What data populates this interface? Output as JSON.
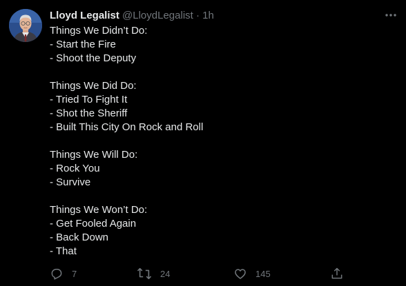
{
  "author": {
    "name": "Lloyd Legalist",
    "handle": "@LloydLegalist",
    "separator": "·",
    "time": "1h"
  },
  "tweet": {
    "lines": [
      "Things We Didn’t Do:",
      "- Start the Fire",
      "- Shoot the Deputy",
      "",
      "Things We Did Do:",
      "- Tried To Fight It",
      "- Shot the Sheriff",
      "- Built This City On Rock and Roll",
      "",
      "Things We Will Do:",
      "- Rock You",
      "- Survive",
      "",
      "Things We Won’t Do:",
      "- Get Fooled Again",
      "- Back Down",
      "- That"
    ]
  },
  "actions": {
    "reply": {
      "icon": "reply-icon",
      "count": "7"
    },
    "retweet": {
      "icon": "retweet-icon",
      "count": "24"
    },
    "like": {
      "icon": "heart-icon",
      "count": "145"
    },
    "share": {
      "icon": "share-icon"
    }
  },
  "colors": {
    "background": "#000000",
    "text": "#e7e9ea",
    "secondary": "#71767b"
  }
}
